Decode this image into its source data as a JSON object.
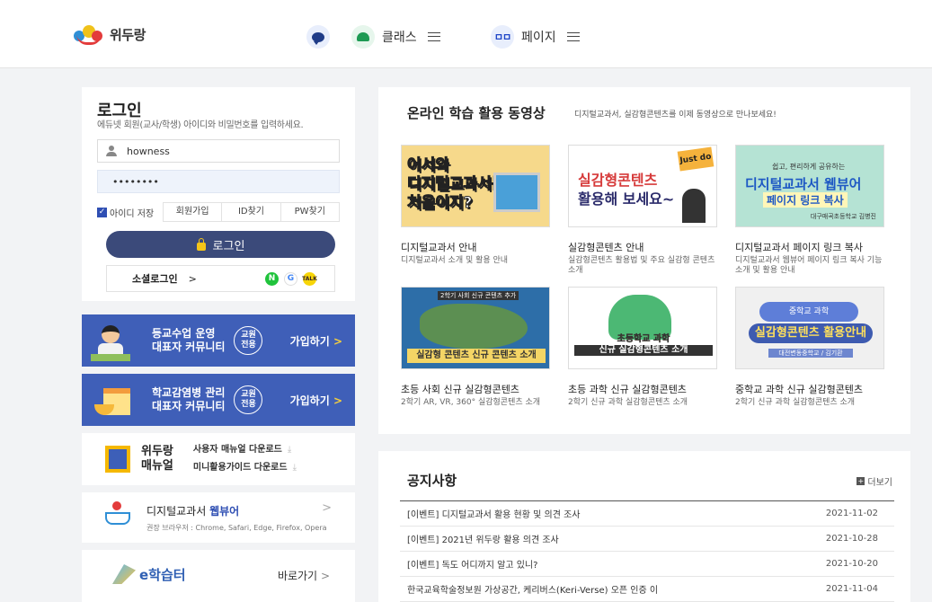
{
  "header": {
    "logo_text": "위두랑",
    "nav": [
      {
        "label": "",
        "icon": "chat-bubble-icon"
      },
      {
        "label": "클래스",
        "icon": "class-icon"
      },
      {
        "label": "페이지",
        "icon": "page-icon",
        "icon_text": "ㅁㅁ"
      }
    ]
  },
  "login": {
    "title": "로그인",
    "description": "에듀넷 회원(교사/학생) 아이디와 비밀번호를 입력하세요.",
    "username_value": "howness",
    "password_value": "••••••••",
    "remember_label": "아이디 저장",
    "remember_checked": true,
    "signup_label": "회원가입",
    "find_id_label": "ID찾기",
    "find_pw_label": "PW찾기",
    "login_button": "로그인",
    "social_label": "소셜로그인",
    "social_arrow": ">",
    "social_icons": [
      "N",
      "G",
      "TALK"
    ]
  },
  "banners": [
    {
      "line1": "등교수업 운영",
      "line2": "대표자 커뮤니티",
      "badge1": "교원",
      "badge2": "전용",
      "join": "가입하기",
      "arrow": ">"
    },
    {
      "line1": "학교감염병 관리",
      "line2": "대표자 커뮤니티",
      "badge1": "교원",
      "badge2": "전용",
      "join": "가입하기",
      "arrow": ">"
    }
  ],
  "manual": {
    "title1": "위두랑",
    "title2": "매뉴얼",
    "download1": "사용자 매뉴얼 다운로드",
    "download2": "미니활용가이드 다운로드",
    "download_icon": "⤓"
  },
  "webviewer": {
    "title_a": "디지털교과서",
    "title_b": "웹뷰어",
    "arrow": ">",
    "browsers": "권장 브라우저 : Chrome, Safari, Edge, Firefox, Opera"
  },
  "ehak": {
    "logo": "e학습터",
    "go": "바로가기",
    "arrow": ">"
  },
  "videos": {
    "title": "온라인 학습 활용 동영상",
    "subtitle": "디지털교과서, 실감형콘텐츠를 이제 동영상으로 만나보세요!",
    "items": [
      {
        "title": "디지털교과서 안내",
        "desc": "디지털교과서 소개 및 활용 안내",
        "thumb_text": [
          "어서와",
          "디지털교과서는",
          "처음이지?"
        ]
      },
      {
        "title": "실감형콘텐츠 안내",
        "desc": "실감형콘텐츠 활용법 및 주요 실감형 콘텐츠 소개",
        "thumb_text": [
          "실감형콘텐츠",
          "활용해 보세요~"
        ],
        "thumb_tag": "Just do"
      },
      {
        "title": "디지털교과서 페이지 링크 복사",
        "desc": "디지털교과서 웹뷰어 페이지 링크 복사 기능 소개 및 활용 안내",
        "thumb_text": [
          "쉽고, 편리하게 공유하는",
          "디지털교과서 웹뷰어",
          "페이지 링크 복사",
          "대구매곡초등학교 김병진"
        ]
      },
      {
        "title": "초등 사회 신규 실감형콘텐츠",
        "desc": "2학기 AR, VR, 360° 실감형콘텐츠 소개",
        "thumb_text": [
          "2학기 사회 신규 콘텐츠 추가",
          "실감형 콘텐츠 신규 콘텐츠 소개"
        ]
      },
      {
        "title": "초등 과학 신규 실감형콘텐츠",
        "desc": "2학기 신규 과학 실감형콘텐츠 소개",
        "thumb_text": [
          "초등학교 과학",
          "신규 실감형콘텐츠 소개"
        ]
      },
      {
        "title": "중학교 과학 신규 실감형콘텐츠",
        "desc": "2학기 신규 과학 실감형콘텐츠 소개",
        "thumb_text": [
          "중학교 과학",
          "실감형콘텐츠 활용안내",
          "대전변동중학교 / 김기환"
        ]
      }
    ]
  },
  "notice": {
    "title": "공지사항",
    "more": "더보기",
    "rows": [
      {
        "title": "[이벤트] 디지털교과서 활용 현황 및 의견 조사",
        "date": "2021-11-02"
      },
      {
        "title": "[이벤트] 2021년 위두랑 활용 의견 조사",
        "date": "2021-10-28"
      },
      {
        "title": "[이벤트] 독도 어디까지 알고 있니?",
        "date": "2021-10-20"
      },
      {
        "title": "한국교육학술정보원 가상공간, 케리버스(Keri-Verse) 오픈 인증 이",
        "date": "2021-11-04"
      }
    ]
  },
  "colors": {
    "primary": "#3b4a7a",
    "banner_blue": "#3f5fb8",
    "accent_yellow": "#f6d03e",
    "background": "#f2f3f5"
  }
}
